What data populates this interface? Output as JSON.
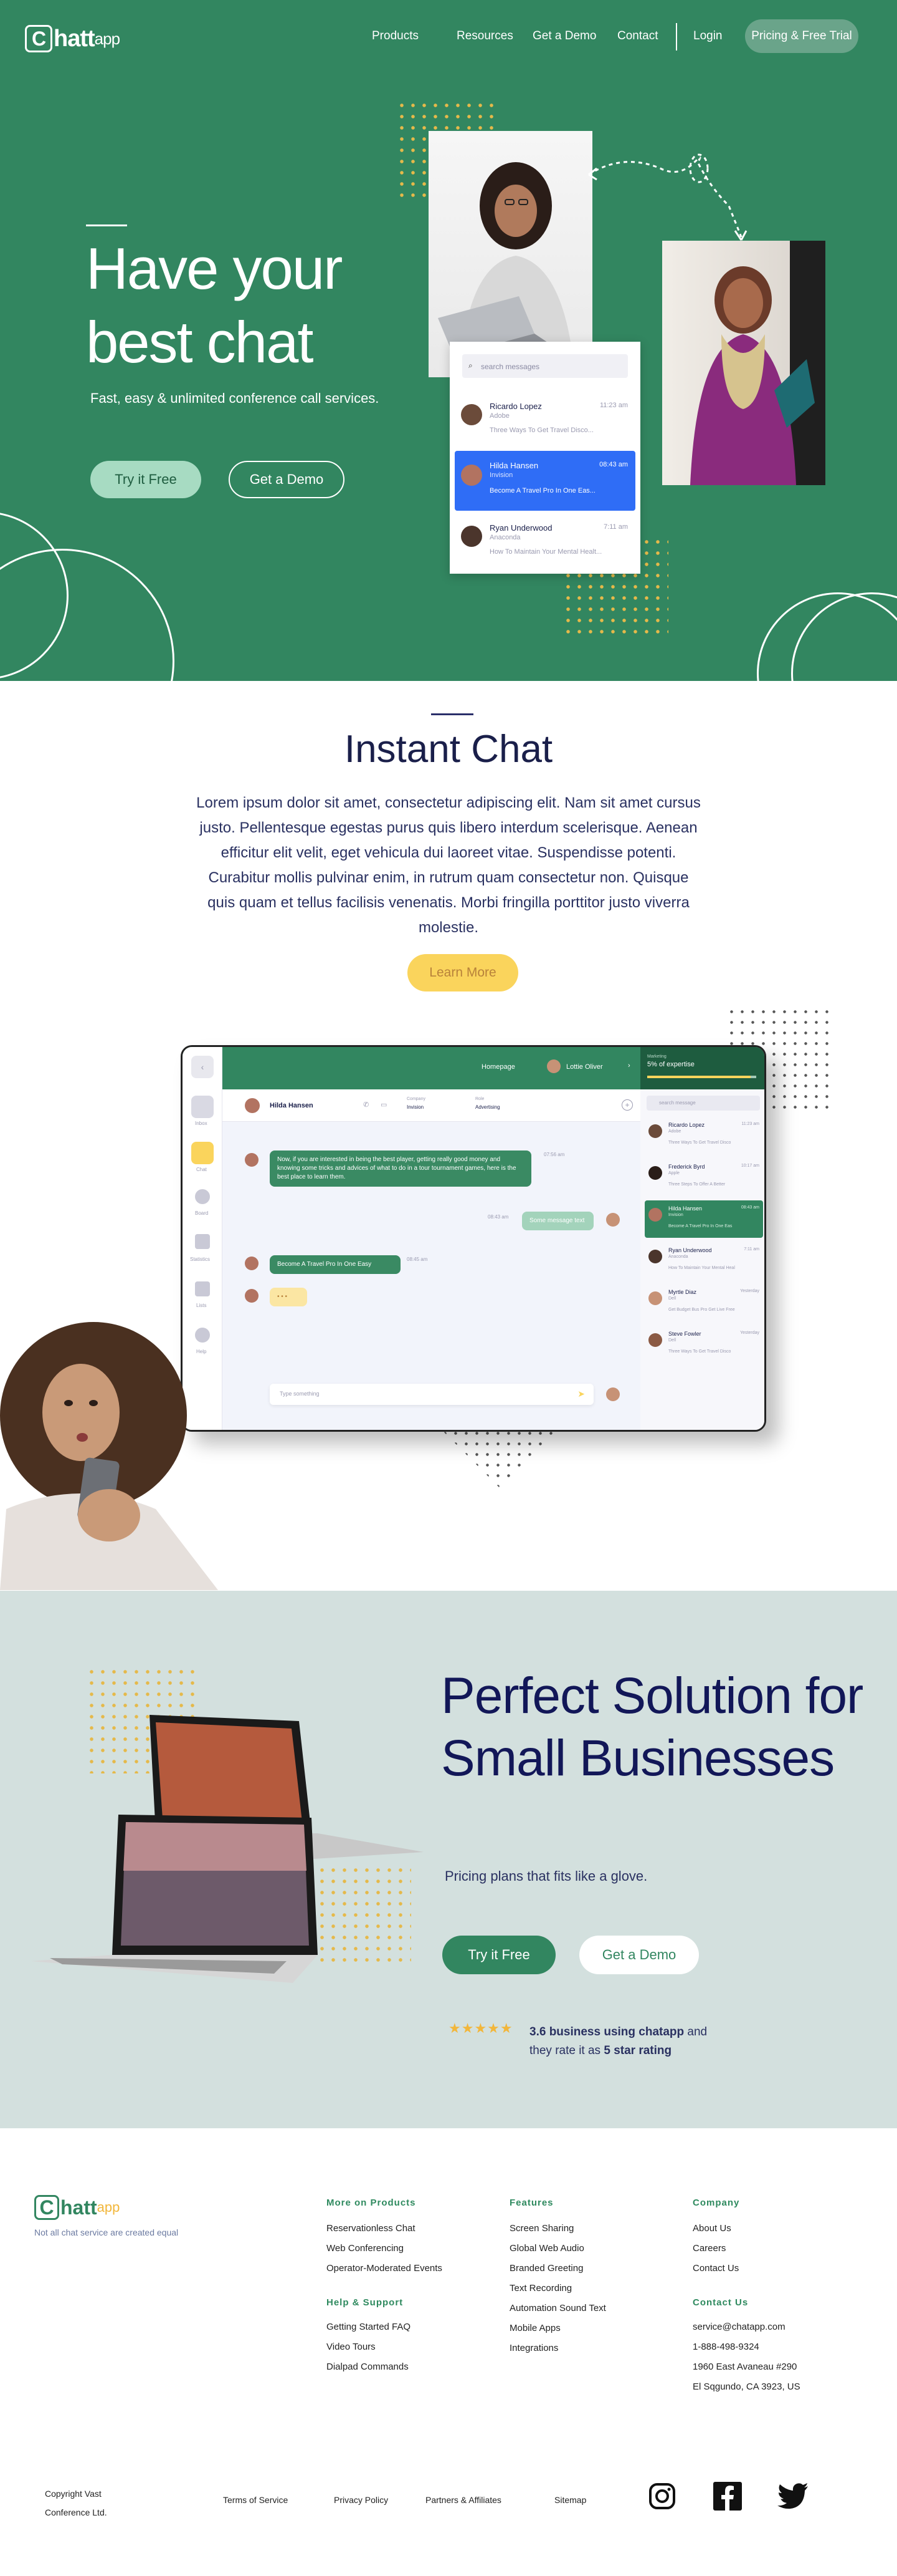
{
  "nav": {
    "logo_letter": "C",
    "logo_text": "hatt",
    "logo_suffix": "app",
    "links": [
      "Products",
      "Resources",
      "Get a Demo",
      "Contact"
    ],
    "login": "Login",
    "cta": "Pricing & Free Trial"
  },
  "hero": {
    "title": "Have your best chat",
    "subtitle": "Fast, easy & unlimited  conference call services.",
    "primary": "Try it Free",
    "secondary": "Get a Demo",
    "search_placeholder": "search messages",
    "messages": [
      {
        "name": "Ricardo Lopez",
        "company": "Adobe",
        "time": "11:23 am",
        "preview": "Three Ways To Get Travel Disco..."
      },
      {
        "name": "Hilda Hansen",
        "company": "Invision",
        "time": "08:43 am",
        "preview": "Become A Travel Pro In One Eas..."
      },
      {
        "name": "Ryan Underwood",
        "company": "Anaconda",
        "time": "7:11 am",
        "preview": "How To Maintain Your Mental Healt..."
      }
    ]
  },
  "instant": {
    "title": "Instant Chat",
    "body": "Lorem ipsum dolor sit amet, consectetur adipiscing elit. Nam sit amet cursus justo. Pellentesque egestas purus quis libero interdum scelerisque. Aenean efficitur elit velit, eget vehicula dui laoreet vitae. Suspendisse potenti. Curabitur mollis pulvinar enim, in rutrum quam consectetur non. Quisque quis quam et tellus facilisis venenatis. Morbi fringilla porttitor justo viverra molestie.",
    "cta": "Learn More"
  },
  "mock": {
    "homepage": "Homepage",
    "user": "Lottie Oliver",
    "expertise_label": "Marketing",
    "expertise": "5% of expertise",
    "expertise_progress": 0.95,
    "contact_name": "Hilda Hansen",
    "company_label": "Company",
    "company": "Invision",
    "role_label": "Role",
    "role": "Advertising",
    "sidebar": [
      "Inbox",
      "Chat",
      "Board",
      "Statistics",
      "Lists",
      "Help"
    ],
    "msg1": "Now, if you are interested in being the best player, getting really good money and knowing some tricks and advices of what to do in a tour tournament games, here is the best place to learn them.",
    "msg1_time": "07:56 am",
    "msg2": "Some message text",
    "msg2_time": "08:43 am",
    "msg3": "Become A Travel Pro In One Easy",
    "msg3_time": "08:45 am",
    "typing": "• • •",
    "input_placeholder": "Type something",
    "search_placeholder": "search message",
    "contacts": [
      {
        "name": "Ricardo Lopez",
        "company": "Adobe",
        "time": "11:23 am",
        "preview": "Three Ways To Get Travel Disco"
      },
      {
        "name": "Frederick Byrd",
        "company": "Apple",
        "time": "10:17 am",
        "preview": "Three Steps To Offer A Better"
      },
      {
        "name": "Hilda Hansen",
        "company": "Invision",
        "time": "08:43 am",
        "preview": "Become A Travel Pro In One Eas"
      },
      {
        "name": "Ryan Underwood",
        "company": "Anaconda",
        "time": "7:11 am",
        "preview": "How To Maintain Your Mental Heal"
      },
      {
        "name": "Myrtle Diaz",
        "company": "Dell",
        "time": "Yesterday",
        "preview": "Get Budget Bus Pro Get Live Free"
      },
      {
        "name": "Steve Fowler",
        "company": "Dell",
        "time": "Yesterday",
        "preview": "Three Ways To Get Travel Disco"
      }
    ]
  },
  "perfect": {
    "title": "Perfect Solution for Small Businesses",
    "subtitle": "Pricing plans that fits like a glove.",
    "primary": "Try it Free",
    "secondary": "Get a Demo",
    "rating_stars": 5,
    "rating_value": "3.6 business using chatapp",
    "rating_mid": " and",
    "rating_line2_pre": "they rate it as ",
    "rating_line2_bold": "5 star rating"
  },
  "footer": {
    "tagline": "Not all chat service are created equal",
    "col1_title": "More on Products",
    "col1": [
      "Reservationless Chat",
      "Web Conferencing",
      "Operator-Moderated Events"
    ],
    "col1b_title": "Help & Support",
    "col1b": [
      "Getting Started FAQ",
      "Video Tours",
      "Dialpad Commands"
    ],
    "col2_title": "Features",
    "col2": [
      "Screen Sharing",
      "Global Web Audio",
      "Branded Greeting",
      "Text Recording",
      "Automation Sound Text",
      "Mobile Apps",
      "Integrations"
    ],
    "col3_title": "Company",
    "col3": [
      "About Us",
      "Careers",
      "Contact Us"
    ],
    "col3b_title": "Contact Us",
    "col3b": [
      "service@chatapp.com",
      "1-888-498-9324",
      "1960 East Avaneau #290",
      "El Sqgundo, CA 3923, US"
    ],
    "copyright1": "Copyright Vast",
    "copyright2": "Conference Ltd.",
    "bottom_links": [
      "Terms of Service",
      "Privacy Policy",
      "Partners & Affiliates",
      "Sitemap"
    ]
  }
}
